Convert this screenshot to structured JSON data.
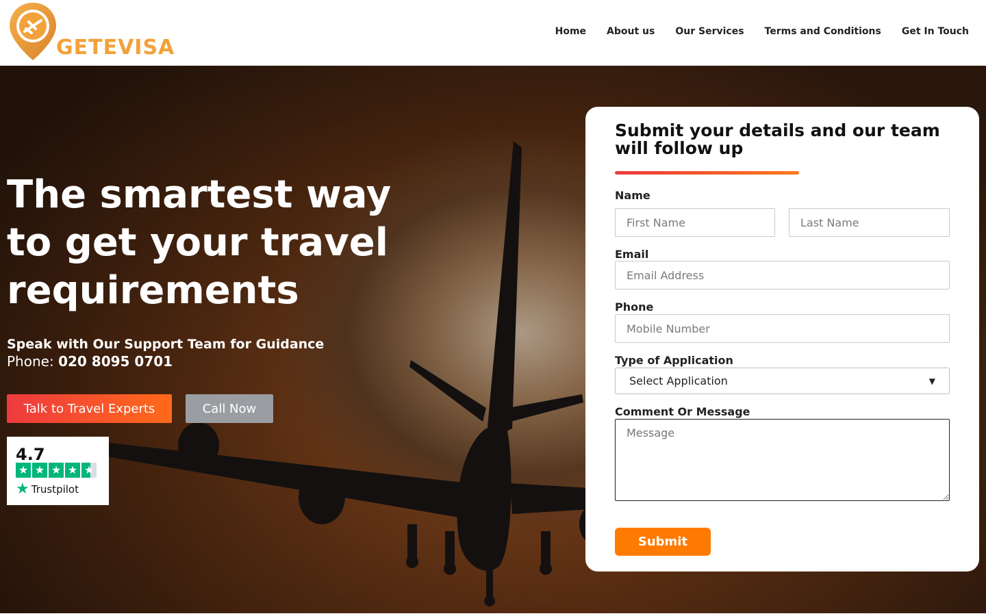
{
  "brand": {
    "logo_text": "GETEVISA",
    "logo_icon": "airplane-pin-icon",
    "color": "#f3a13a"
  },
  "nav": {
    "items": [
      {
        "label": "Home"
      },
      {
        "label": "About us"
      },
      {
        "label": "Our Services"
      },
      {
        "label": "Terms and Conditions"
      },
      {
        "label": "Get In Touch"
      }
    ]
  },
  "hero": {
    "title": "The smartest way to get your travel requirements",
    "support_text": "Speak with Our Support Team for Guidance",
    "phone_label": "Phone: ",
    "phone_number": "020 8095 0701",
    "experts_button": "Talk to Travel Experts",
    "call_button": "Call Now",
    "background_image": "airplane-silhouette-sunset"
  },
  "trustpilot": {
    "score": "4.7",
    "rating": 4.7,
    "max_rating": 5,
    "brand": "Trustpilot",
    "star_color": "#00b67a"
  },
  "form": {
    "title": "Submit your details and our team will follow up",
    "name_label": "Name",
    "first_name_placeholder": "First Name",
    "last_name_placeholder": "Last Name",
    "email_label": "Email",
    "email_placeholder": "Email Address",
    "phone_label": "Phone",
    "phone_placeholder": "Mobile Number",
    "application_label": "Type of Application",
    "application_selected": "Select Application",
    "message_label": "Comment Or Message",
    "message_placeholder": "Message",
    "submit_label": "Submit",
    "accent_color": "#ff7a00"
  }
}
